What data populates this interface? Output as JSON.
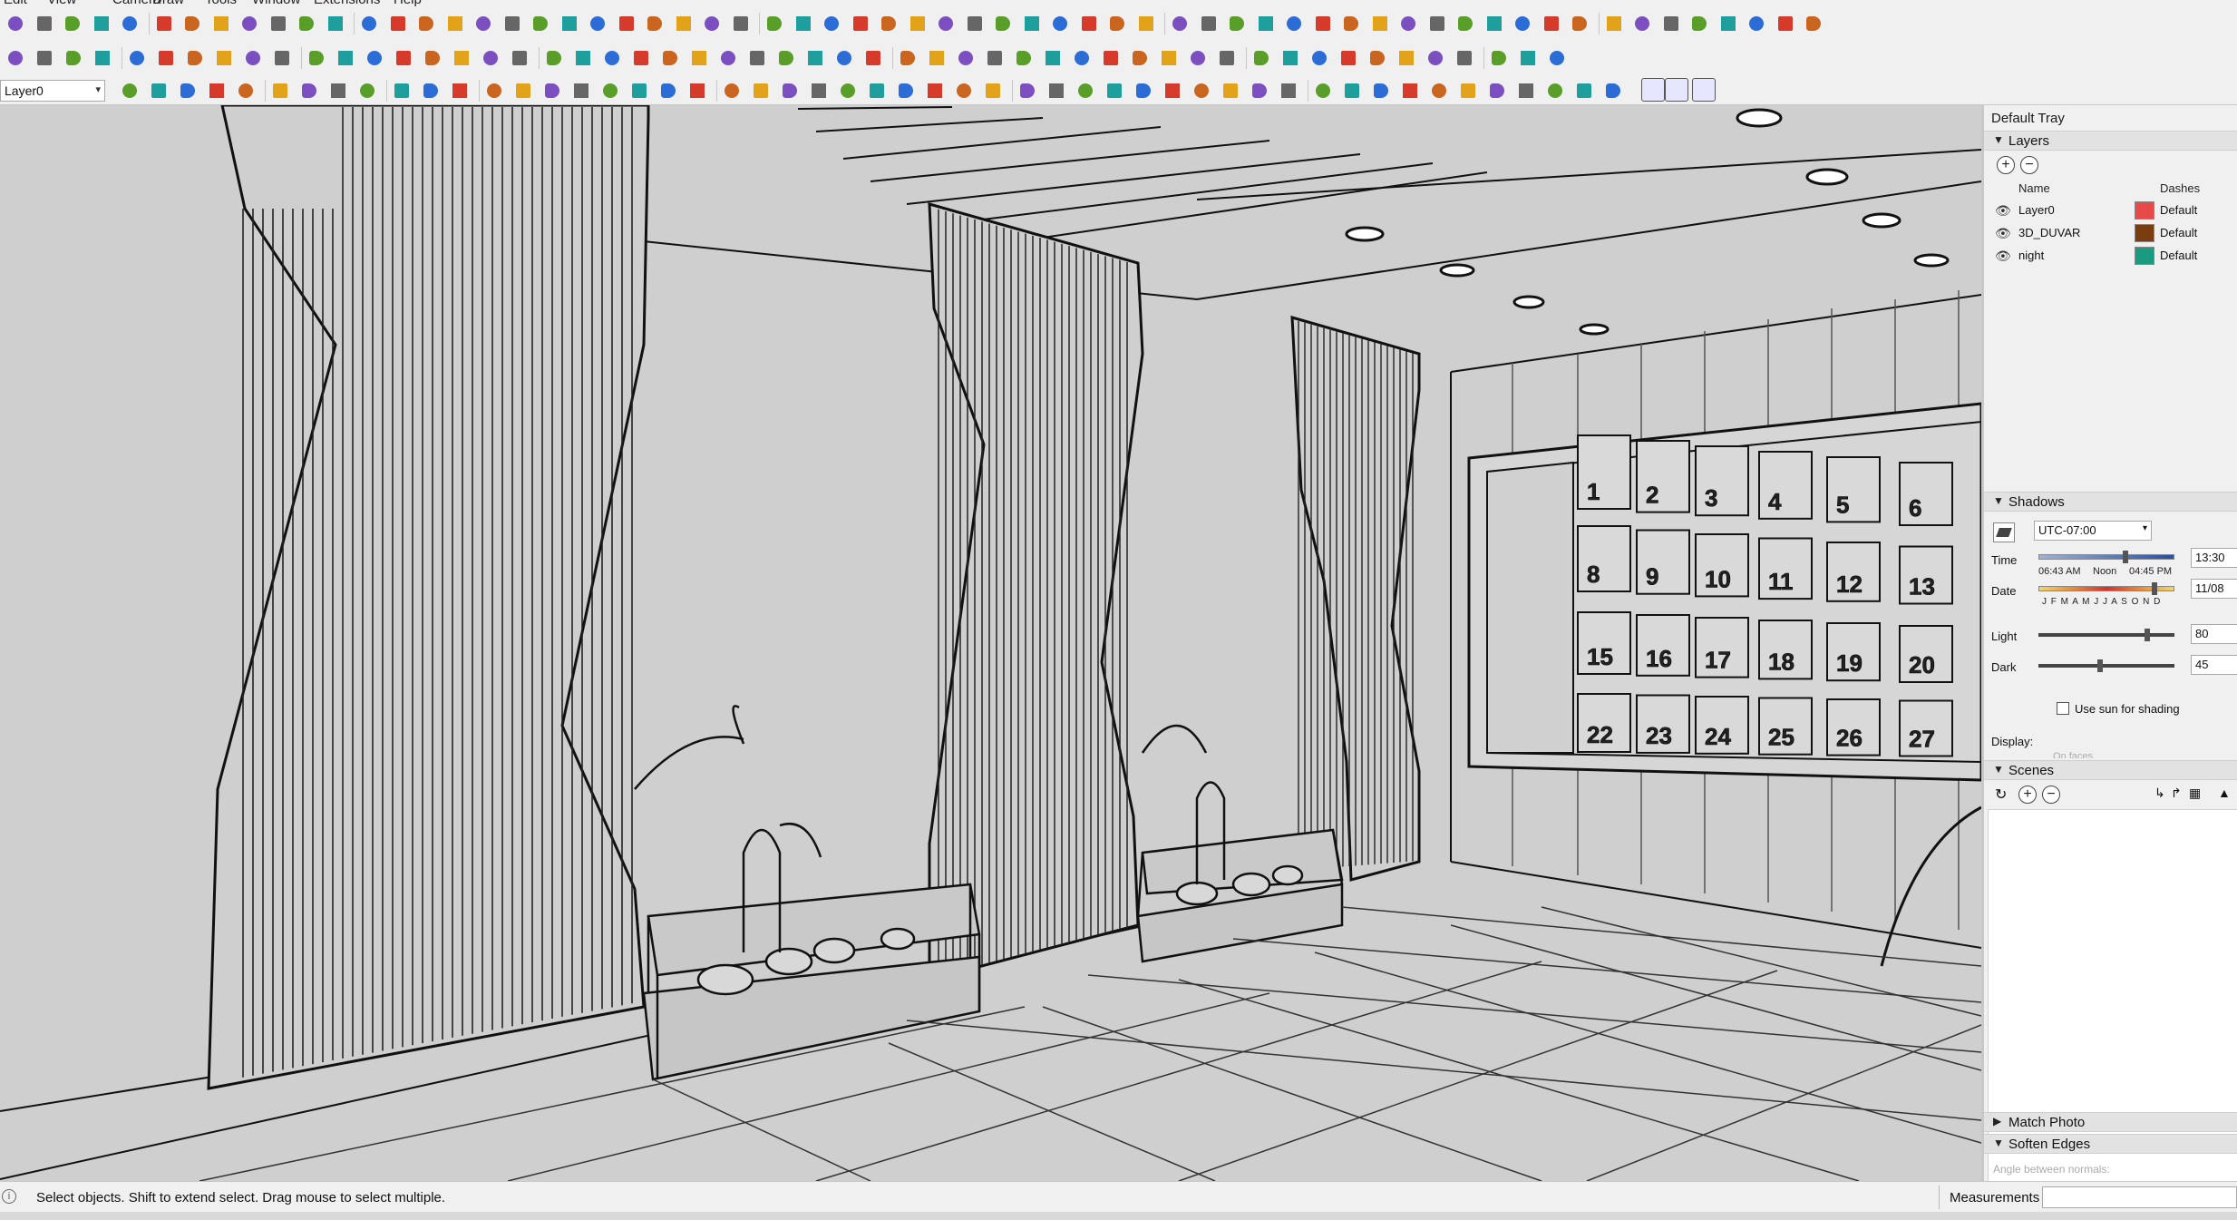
{
  "menubar": {
    "items": [
      "Edit",
      "View",
      "Camera",
      "Draw",
      "Tools",
      "Window",
      "Extensions",
      "Help"
    ]
  },
  "toolbar": {
    "layer_select_value": "Layer0"
  },
  "tray": {
    "title": "Default Tray",
    "layers_panel": {
      "label": "Layers",
      "col_name": "Name",
      "col_dashes": "Dashes",
      "rows": [
        {
          "name": "Layer0",
          "color": "#e84a4a",
          "dashes": "Default"
        },
        {
          "name": "3D_DUVAR",
          "color": "#7a3d0f",
          "dashes": "Default"
        },
        {
          "name": "night",
          "color": "#1a9a7e",
          "dashes": "Default"
        }
      ]
    },
    "shadows_panel": {
      "label": "Shadows",
      "timezone": "UTC-07:00",
      "time_label": "Time",
      "time_start": "06:43 AM",
      "time_noon": "Noon",
      "time_end": "04:45 PM",
      "time_value": "13:30",
      "time_fraction": 0.64,
      "date_label": "Date",
      "months": "J F M A M J J A S O N D",
      "date_value": "11/08",
      "date_fraction": 0.85,
      "light_label": "Light",
      "light_value": "80",
      "light_fraction": 0.8,
      "dark_label": "Dark",
      "dark_value": "45",
      "dark_fraction": 0.45,
      "use_sun_label": "Use sun for shading",
      "display_label": "Display:",
      "display_sub": "On faces"
    },
    "scenes_panel": {
      "label": "Scenes"
    },
    "match_photo_panel": {
      "label": "Match Photo"
    },
    "soften_edges_panel": {
      "label": "Soften Edges",
      "sub": "Angle between normals:"
    }
  },
  "viewport": {
    "mailbox_numbers": [
      [
        "1",
        "2",
        "3",
        "4",
        "5",
        "6"
      ],
      [
        "8",
        "9",
        "10",
        "11",
        "12",
        "13"
      ],
      [
        "15",
        "16",
        "17",
        "18",
        "19",
        "20"
      ],
      [
        "22",
        "23",
        "24",
        "25",
        "26",
        "27"
      ]
    ]
  },
  "statusbar": {
    "text": "Select objects. Shift to extend select. Drag mouse to select multiple.",
    "measurements_label": "Measurements"
  },
  "colors": {
    "viewport_bg": "#cfcfcf",
    "line": "#111111",
    "tray_bg": "#f0f0f0"
  }
}
